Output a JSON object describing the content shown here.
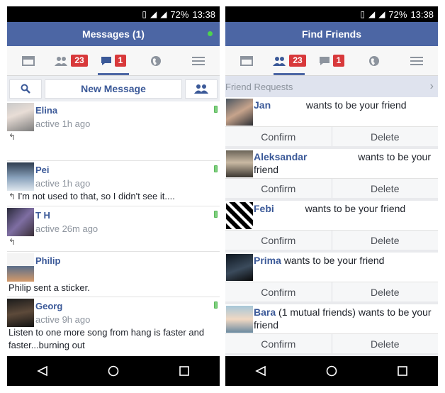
{
  "status": {
    "battery": "72%",
    "time": "13:38"
  },
  "left": {
    "title": "Messages (1)",
    "tabs": {
      "friend_badge": "23",
      "message_badge": "1"
    },
    "toolbar": {
      "new_message_label": "New Message"
    },
    "conversations": [
      {
        "name": "Elina",
        "active": "active 1h ago",
        "preview": ""
      },
      {
        "name": "Pei",
        "active": "active 1h ago",
        "preview": "I'm not used to that, so I didn't see it...."
      },
      {
        "name": "T H",
        "active": "active 26m ago",
        "preview": ""
      },
      {
        "name": "Philip",
        "active": "",
        "preview": "Philip sent a sticker."
      },
      {
        "name": "Georg",
        "active": "active 9h ago",
        "preview": "Listen to one more song from hang is faster and faster...burning out"
      }
    ]
  },
  "right": {
    "title": "Find Friends",
    "tabs": {
      "friend_badge": "23",
      "message_badge": "1"
    },
    "section_header": "Friend Requests",
    "requests": [
      {
        "name": "Jan",
        "text": "wants to be your friend"
      },
      {
        "name": "Aleksandar",
        "text": "wants to be your friend"
      },
      {
        "name": "Febi",
        "text": "wants to be your friend"
      },
      {
        "name": "Prima",
        "text": "wants to be your friend"
      },
      {
        "name": "Bara",
        "text": "(1 mutual friends) wants to be your friend"
      }
    ],
    "confirm_label": "Confirm",
    "delete_label": "Delete"
  }
}
